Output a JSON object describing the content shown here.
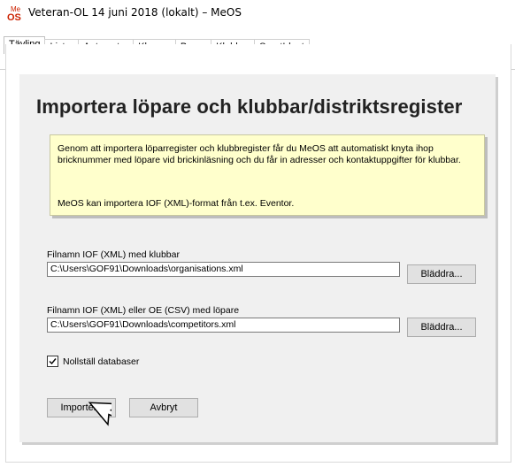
{
  "window": {
    "title": "Veteran-OL 14 juni 2018 (lokalt) – MeOS",
    "icon": "meos-logo-icon",
    "icon_text_top": "Me",
    "icon_text_bottom": "OS"
  },
  "tabs": [
    {
      "label": "Tävling",
      "active": true
    },
    {
      "label": "Listor",
      "active": false
    },
    {
      "label": "Automater",
      "active": false
    },
    {
      "label": "Klasser",
      "active": false
    },
    {
      "label": "Banor",
      "active": false
    },
    {
      "label": "Klubbar",
      "active": false
    },
    {
      "label": "SportIdent",
      "active": false
    }
  ],
  "dialog": {
    "heading": "Importera löpare och klubbar/distriktsregister",
    "info_paragraph_1": "Genom att importera löparregister och klubbregister får du MeOS att automatiskt knyta ihop bricknummer med löpare vid brickinläsning och du får in adresser och kontaktuppgifter för klubbar.",
    "info_paragraph_2": "MeOS kan importera IOF (XML)-format från t.ex. Eventor.",
    "clubs_label": "Filnamn IOF (XML) med klubbar",
    "clubs_value": "C:\\Users\\GOF91\\Downloads\\organisations.xml",
    "clubs_browse": "Bläddra...",
    "runners_label": "Filnamn IOF (XML) eller OE (CSV) med löpare",
    "runners_value": "C:\\Users\\GOF91\\Downloads\\competitors.xml",
    "runners_browse": "Bläddra...",
    "reset_db_label": "Nollställ databaser",
    "reset_db_checked": true,
    "import_button": "Importera",
    "cancel_button": "Avbryt"
  },
  "colors": {
    "info_background": "#ffffcc",
    "panel_background": "#f0f0f0",
    "icon_red": "#cc2200",
    "icon_blue": "#3366cc"
  }
}
